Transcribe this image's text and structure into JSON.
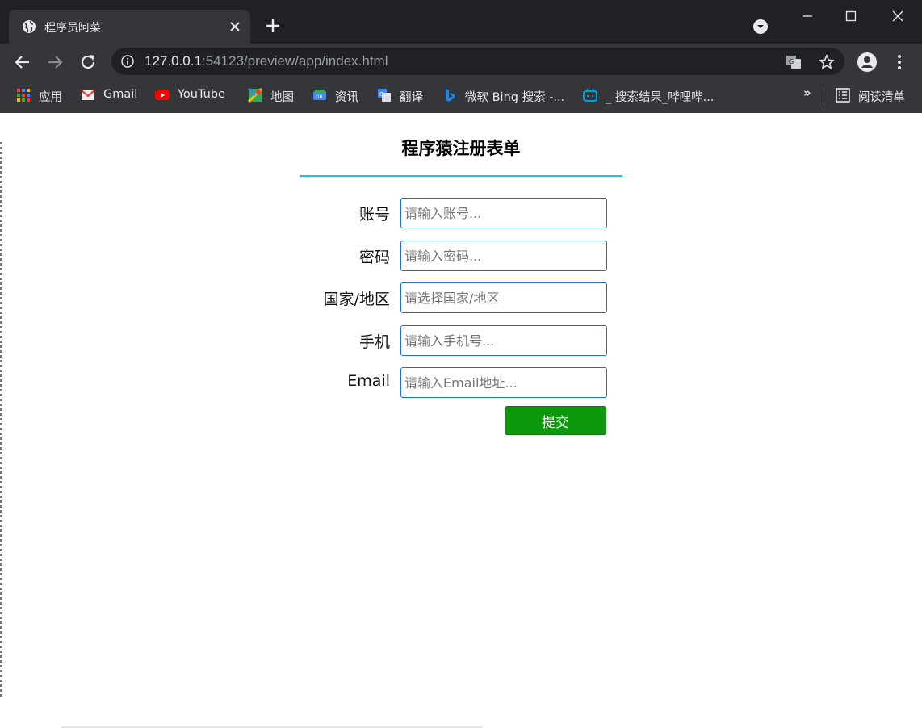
{
  "browser": {
    "tab_title": "程序员阿菜",
    "url_host": "127.0.0.1",
    "url_rest": ":54123/preview/app/index.html",
    "bookmarks": [
      {
        "label": "应用",
        "icon": "apps-grid-icon"
      },
      {
        "label": "Gmail",
        "icon": "gmail-icon"
      },
      {
        "label": "YouTube",
        "icon": "youtube-icon"
      },
      {
        "label": "地图",
        "icon": "maps-icon"
      },
      {
        "label": "资讯",
        "icon": "news-icon"
      },
      {
        "label": "翻译",
        "icon": "translate-icon"
      },
      {
        "label": "微软 Bing 搜索 -...",
        "icon": "bing-icon"
      },
      {
        "label": "_ 搜索结果_哔哩哔...",
        "icon": "bilibili-icon"
      }
    ],
    "more_bookmarks": "»",
    "reading_list": "阅读清单"
  },
  "form": {
    "title": "程序猿注册表单",
    "fields": [
      {
        "label": "账号",
        "placeholder": "请输入账号..."
      },
      {
        "label": "密码",
        "placeholder": "请输入密码..."
      },
      {
        "label": "国家/地区",
        "placeholder": "请选择国家/地区"
      },
      {
        "label": "手机",
        "placeholder": "请输入手机号..."
      },
      {
        "label": "Email",
        "placeholder": "请输入Email地址..."
      }
    ],
    "submit_label": "提交"
  },
  "colors": {
    "title_rule": "#1ec0f0",
    "input_border": "#1c6fd1",
    "submit_bg": "#0c9a0c"
  }
}
